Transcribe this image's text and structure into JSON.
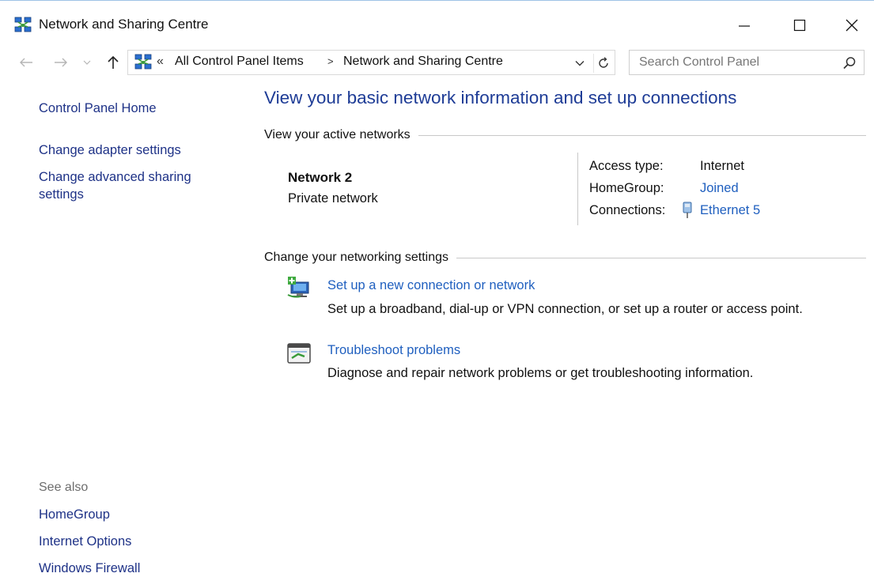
{
  "window": {
    "title": "Network and Sharing Centre"
  },
  "address_bar": {
    "overflow_chevron": "«",
    "breadcrumbs": [
      "All Control Panel Items",
      "Network and Sharing Centre"
    ],
    "separator": ">"
  },
  "search": {
    "placeholder": "Search Control Panel"
  },
  "left_pane": {
    "links": [
      "Control Panel Home",
      "Change adapter settings",
      "Change advanced sharing",
      "settings"
    ],
    "see_also": {
      "heading": "See also",
      "links": [
        "HomeGroup",
        "Internet Options",
        "Windows Firewall"
      ]
    }
  },
  "main": {
    "title": "View your basic network information and set up connections",
    "active_networks": {
      "heading": "View your active networks",
      "network_name": "Network  2",
      "network_type": "Private network",
      "details": [
        {
          "label": "Access type:",
          "value": "Internet",
          "is_link": false
        },
        {
          "label": "HomeGroup:",
          "value": "Joined",
          "is_link": true
        },
        {
          "label": "Connections:",
          "value": "Ethernet 5",
          "is_link": true,
          "icon": "ethernet-icon"
        }
      ]
    },
    "networking_settings": {
      "heading": "Change your networking settings",
      "tasks": [
        {
          "icon": "new-connection-icon",
          "title": "Set up a new connection or network",
          "description": "Set up a broadband, dial-up or VPN connection, or set up a router or access point."
        },
        {
          "icon": "troubleshoot-icon",
          "title": "Troubleshoot problems",
          "description": "Diagnose and repair network problems or get troubleshooting information."
        }
      ]
    }
  },
  "colors": {
    "link": "#1f5fbf",
    "left_link": "#1e3287",
    "title": "#1e3c96",
    "muted": "#6d6d6d"
  }
}
